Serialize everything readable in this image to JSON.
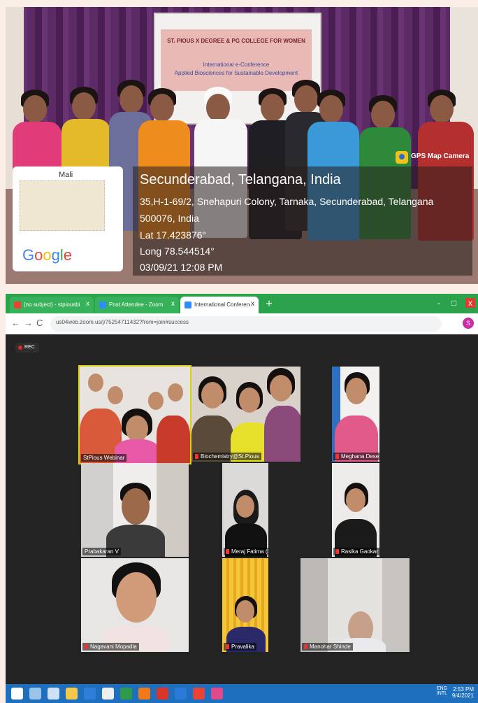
{
  "photo": {
    "screen_lines": [
      "ST. PIOUS X DEGREE & PG COLLEGE FOR WOMEN",
      "International e-Conference",
      "Applied Biosciences for Sustainable Development"
    ],
    "map_label": "Mali",
    "google_logo": [
      "G",
      "o",
      "o",
      "g",
      "l",
      "e"
    ],
    "google_colors": [
      "#4285f4",
      "#ea4335",
      "#fbbc05",
      "#4285f4",
      "#34a853",
      "#ea4335"
    ],
    "gps_badge": "GPS Map Camera",
    "gps": {
      "city": "Secunderabad, Telangana, India",
      "address1": "35,H-1-69/2, Snehapuri Colony, Tarnaka, Secunderabad, Telangana",
      "address2": "500076, India",
      "lat": "Lat 17.423876°",
      "long": "Long 78.544514°",
      "datetime": "03/09/21 12:08 PM"
    }
  },
  "browser": {
    "tabs": [
      {
        "title": "(no subject) - stpiousbiochemi",
        "close": "x",
        "favicon_color": "#ea4335"
      },
      {
        "title": "Post Attendee - Zoom",
        "close": "x",
        "favicon_color": "#2d8cff"
      },
      {
        "title": "International Conference -",
        "close": "x",
        "favicon_color": "#2d8cff"
      }
    ],
    "new_tab": "+",
    "window_controls": [
      "-",
      "□",
      "x"
    ],
    "nav": {
      "back": "←",
      "forward": "→",
      "reload": "C"
    },
    "url": "us04web.zoom.us/j/75254711432?from=join#success",
    "avatar": "S",
    "rec": "REC"
  },
  "participants": [
    "StPious Webinar",
    "Biochemistry@St.Pious",
    "Meghana Desetty",
    "Prabakaran V",
    "Meraj Fatima (Secunderabad)",
    "Rasika Gaokar",
    "Nagavani Mopadla",
    "Pravalika",
    "Manohar Shinde"
  ],
  "taskbar": {
    "lang": "ENG",
    "lang2": "INTL",
    "time": "2:53 PM",
    "date": "9/4/2021"
  }
}
